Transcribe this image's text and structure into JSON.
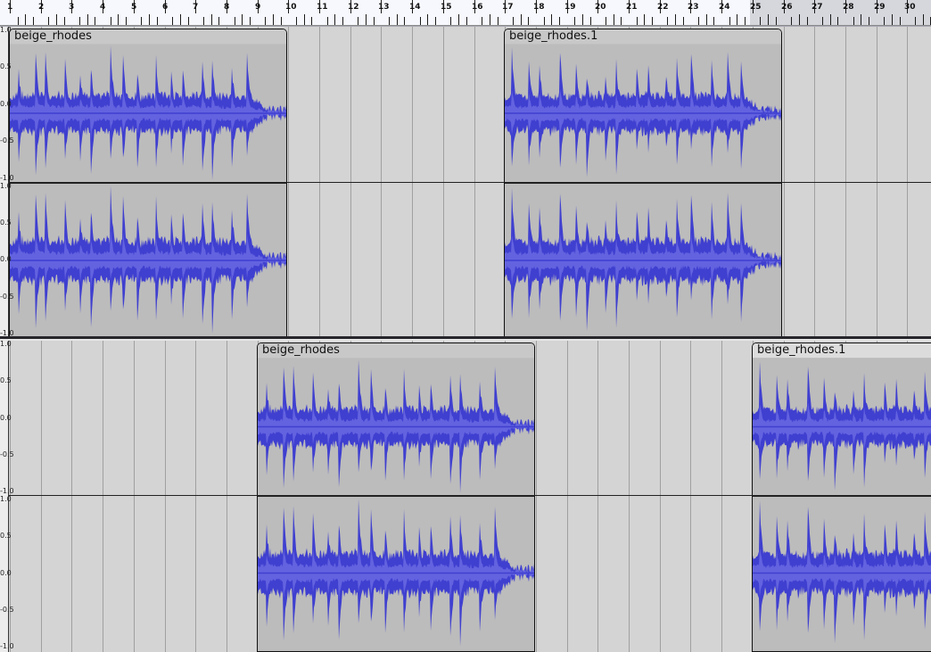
{
  "ruler": {
    "labels": [
      "1",
      "2",
      "3",
      "4",
      "5",
      "6",
      "7",
      "8",
      "9",
      "10",
      "11",
      "12",
      "13",
      "14",
      "15",
      "16",
      "17",
      "18",
      "19",
      "20",
      "21",
      "22",
      "23",
      "24",
      "25",
      "26",
      "27",
      "28",
      "29",
      "30"
    ]
  },
  "vscale": {
    "labels": [
      "1.0",
      "0.5",
      "0.0",
      "-0.5",
      "-1.0"
    ]
  },
  "tracks": [
    {
      "clips": [
        {
          "name": "beige_rhodes"
        },
        {
          "name": "beige_rhodes.1"
        }
      ]
    },
    {
      "clips": [
        {
          "name": "beige_rhodes"
        },
        {
          "name": "beige_rhodes.1"
        }
      ]
    }
  ],
  "colors": {
    "wave_outer": "#3f3fd0",
    "wave_inner": "#6363e0",
    "clip_bg": "#bcbcbc",
    "track_bg": "#d4d4d4"
  }
}
